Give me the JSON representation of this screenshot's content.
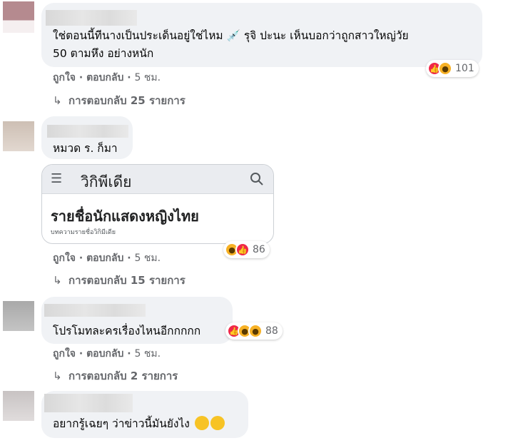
{
  "comments": [
    {
      "text": "ใช่ตอนนี้ทีนางเป็นประเด็นอยู่ใช่ไหม 💉 รุจิ ปะนะ เห็นบอกว่าถูกสาวใหญ่วัย 50 ตามหึง อย่างหนัก",
      "line1": "ใช่ตอนนี้ทีนางเป็นประเด็นอยู่ใช่ไหม",
      "line1b": "รุจิ ปะนะ เห็นบอกว่าถูกสาวใหญ่วัย",
      "line2": "50 ตามหึง อย่างหนัก",
      "like": "ถูกใจ",
      "reply": "ตอบกลับ",
      "time": "5 ชม.",
      "reaction_count": "101",
      "reactions": [
        "like",
        "wow"
      ],
      "replies_label": "การตอบกลับ 25 รายการ"
    },
    {
      "text": "หมวด ร. ก็มา",
      "like": "ถูกใจ",
      "reply": "ตอบกลับ",
      "time": "5 ชม.",
      "reaction_count": "86",
      "reactions": [
        "haha",
        "like"
      ],
      "replies_label": "การตอบกลับ 15 รายการ",
      "attachment": {
        "brand": "วิกิพีเดีย",
        "title": "รายชื่อนักแสดงหญิงไทย",
        "subtitle": "บทความรายชื่อวิกิมีเดีย"
      }
    },
    {
      "text": "โปรโมทละครเรื่องไหนอีกกกกก",
      "like": "ถูกใจ",
      "reply": "ตอบกลับ",
      "time": "5 ชม.",
      "reaction_count": "88",
      "reactions": [
        "like",
        "haha",
        "haha"
      ],
      "replies_label": "การตอบกลับ 2 รายการ"
    },
    {
      "text": "อยากรู้เฉยๆ ว่าข่าวนี้มันยังไง",
      "emojis": [
        "pleading-face",
        "flushed-face"
      ]
    }
  ],
  "separator": "·",
  "colors": {
    "bubble": "#f0f2f5",
    "meta": "#65676b",
    "like": "#f02849",
    "yellow": "#f7b125"
  }
}
